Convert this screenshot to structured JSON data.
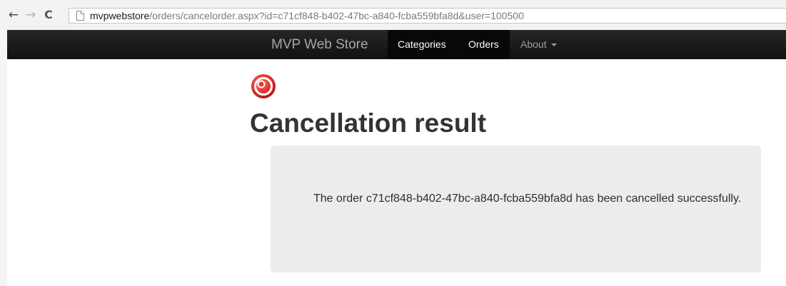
{
  "browser": {
    "url_domain": "mvpwebstore",
    "url_path": "/orders/cancelorder.aspx?id=c71cf848-b402-47bc-a840-fcba559bfa8d&user=100500",
    "icons": [
      "back-arrow-icon",
      "forward-arrow-icon",
      "reload-icon",
      "page-icon"
    ]
  },
  "navbar": {
    "brand": "MVP Web Store",
    "items": [
      {
        "label": "Categories"
      },
      {
        "label": "Orders"
      },
      {
        "label": "About"
      }
    ],
    "background": "#1b1b1b",
    "active_background": "#080808"
  },
  "main": {
    "status_icon": "cancel-status-icon",
    "status_color": "#d9262a",
    "title": "Cancellation result",
    "message": "The order c71cf848-b402-47bc-a840-fcba559bfa8d has been cancelled successfully."
  }
}
